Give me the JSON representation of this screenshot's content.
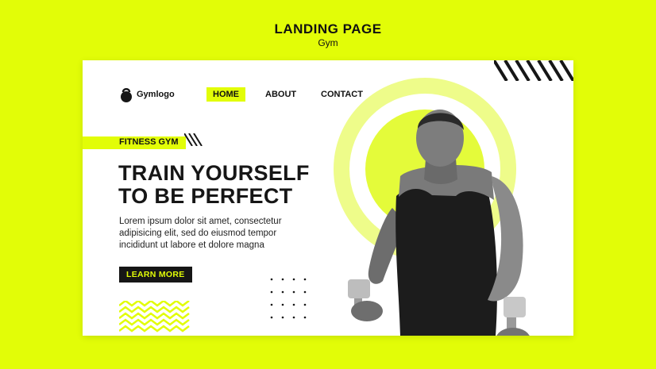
{
  "header": {
    "title": "LANDING PAGE",
    "subtitle": "Gym"
  },
  "brand": {
    "name": "Gymlogo",
    "icon": "kettlebell-icon"
  },
  "nav": {
    "home": "HOME",
    "about": "ABOUT",
    "contact": "CONTACT"
  },
  "hero": {
    "tag": "FITNESS GYM",
    "headline_line1": "TRAIN YOURSELF",
    "headline_line2": "TO BE PERFECT",
    "body_line1": "Lorem ipsum dolor sit amet, consectetur",
    "body_line2": "adipisicing elit, sed do eiusmod tempor",
    "body_line3": "incididunt ut labore et dolore magna",
    "cta": "LEARN MORE"
  },
  "colors": {
    "accent": "#e2fd07",
    "dark": "#161616",
    "card": "#ffffff",
    "circle": "#e4fb3a"
  }
}
